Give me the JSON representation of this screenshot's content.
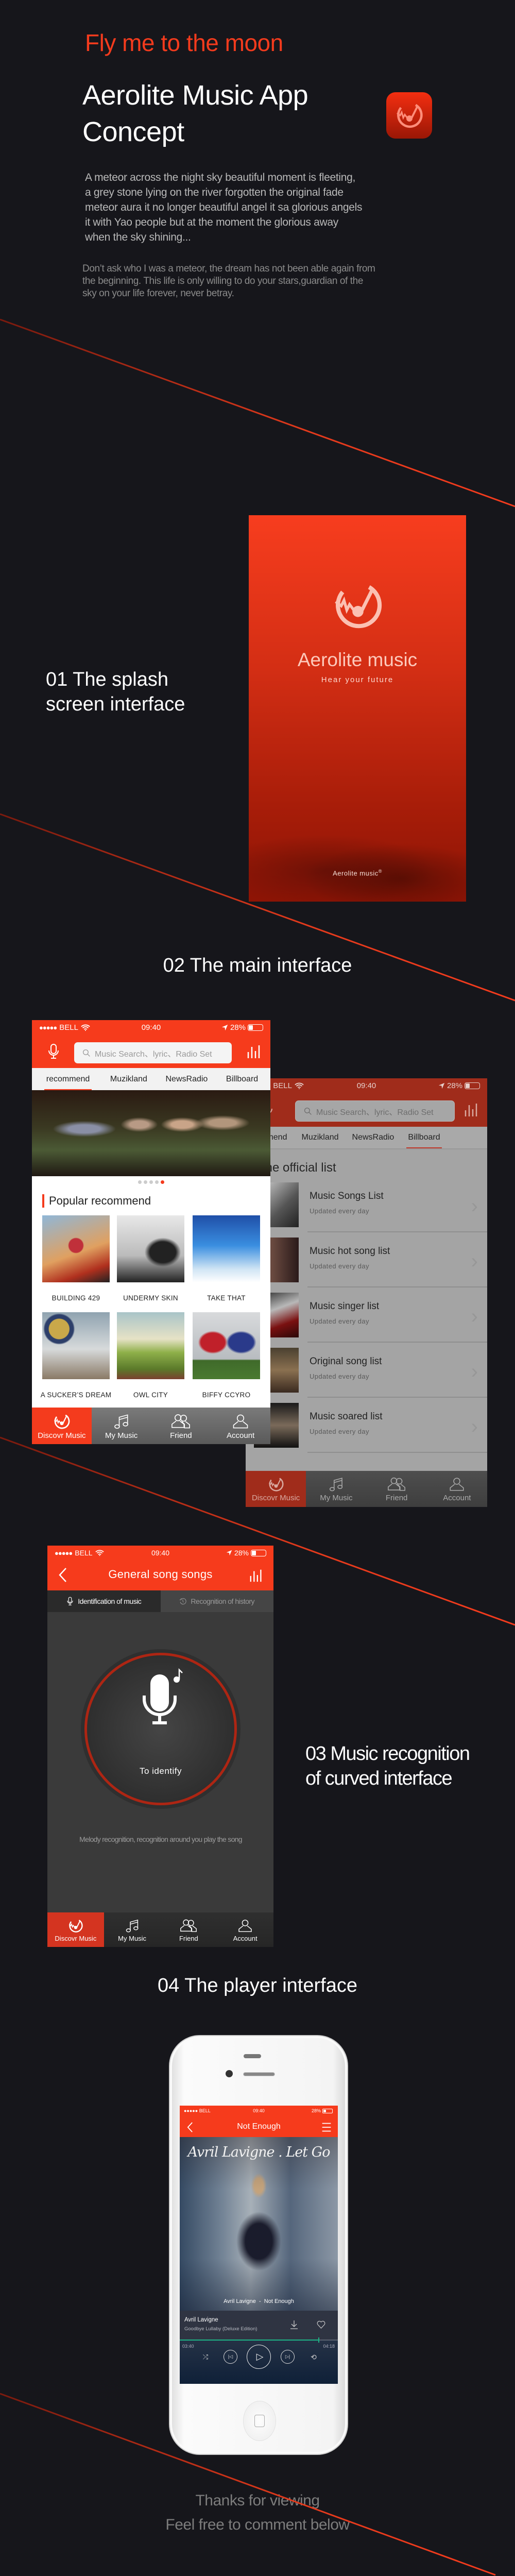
{
  "intro": {
    "tagline": "Fly me to the moon",
    "title_lines": [
      "Aerolite Music App",
      "Concept"
    ],
    "description_lines": [
      "A meteor across the night sky beautiful moment is fleeting,",
      "a grey stone lying on the river forgotten the original fade",
      "meteor aura it no longer beautiful angel it sa glorious angels",
      "it with Yao people but at the moment the glorious away",
      "when the sky shining..."
    ],
    "quote_lines": [
      "Don’t ask who I was a meteor, the dream has not been able again from",
      "the beginning. This life is only willing to do your stars,guardian of the",
      "sky on your life forever, never betray."
    ]
  },
  "sections": {
    "splash": [
      "01  The splash",
      "screen interface"
    ],
    "main": "02  The main interface",
    "recognition": [
      "03 Music recognition",
      "of curved interface"
    ],
    "player": "04  The player interface"
  },
  "status": {
    "carrier": "BELL",
    "signal": "●●●●●",
    "time": "09:40",
    "battery": "28%",
    "battery_level": 0.28
  },
  "splash": {
    "brand": "Aerolite music",
    "slogan": "Hear your future",
    "footer": "Aerolite music",
    "registered": "®"
  },
  "main_screen": {
    "search_placeholder": "Music Search、lyric、Radio Set",
    "tabs": [
      "recommend",
      "Muzikland",
      "NewsRadio",
      "Billboard"
    ],
    "active_tab": "recommend",
    "banner_page": 5,
    "banner_pages": 5,
    "section_title": "Popular recommend",
    "albums": [
      {
        "title": "BUILDING 429"
      },
      {
        "title": "UNDERMY SKIN"
      },
      {
        "title": "TAKE THAT"
      },
      {
        "title": "A SUCKER’S DREAM"
      },
      {
        "title": "OWL CITY"
      },
      {
        "title": "BIFFY CCYRO"
      }
    ]
  },
  "billboard_screen": {
    "active_tab": "Billboard",
    "heading": "The official list",
    "items": [
      {
        "title": "Music Songs List",
        "subtitle": "Updated every day"
      },
      {
        "title": "Music hot song list",
        "subtitle": "Updated every day"
      },
      {
        "title": "Music singer list",
        "subtitle": "Updated every day"
      },
      {
        "title": "Original song list",
        "subtitle": "Updated every day"
      },
      {
        "title": "Music soared list",
        "subtitle": "Updated every day"
      }
    ]
  },
  "tabbar": [
    "Discovr Music",
    "My Music",
    "Friend",
    "Account"
  ],
  "recognition_screen": {
    "title": "General song songs",
    "tabs": [
      "Identification of music",
      "Recognition of history"
    ],
    "button_label": "To identify",
    "hint": "Melody recognition, recognition around you play the song"
  },
  "player_screen": {
    "title": "Not Enough",
    "cover_text": "Avril Lavigne . Let Go",
    "caption": "Avril Lavigne  -  Not Enough",
    "artist": "Avril Lavigne",
    "album": "Goodbye Lullaby (Deluxe Edition)",
    "elapsed": "03:40",
    "duration": "04:18",
    "progress": 0.88
  },
  "closing": [
    "Thanks for viewing",
    "Feel free to comment below"
  ],
  "colors": {
    "accent": "#f43b1d",
    "background": "#16161b",
    "progress": "#1db386"
  }
}
